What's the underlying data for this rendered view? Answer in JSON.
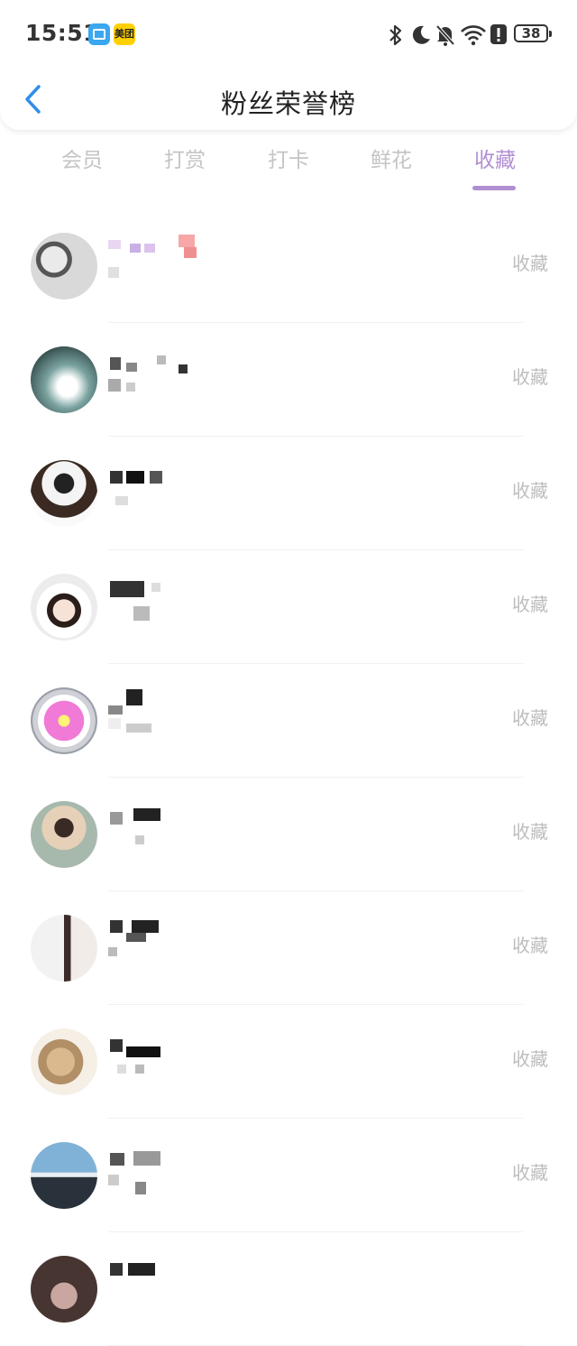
{
  "status_bar": {
    "time": "15:51",
    "app_badges": [
      "book-app-icon",
      "美团"
    ],
    "icons": [
      "bluetooth-icon",
      "moon-icon",
      "bell-muted-icon",
      "wifi-icon",
      "alert-icon"
    ],
    "battery": "38"
  },
  "header": {
    "back_icon": "chevron-left-icon",
    "title": "粉丝荣誉榜"
  },
  "tabs": [
    {
      "label": "会员",
      "active": false
    },
    {
      "label": "打赏",
      "active": false
    },
    {
      "label": "打卡",
      "active": false
    },
    {
      "label": "鲜花",
      "active": false
    },
    {
      "label": "收藏",
      "active": true
    }
  ],
  "colors": {
    "accent": "#b18fd3",
    "tab_inactive": "#c4c4c4",
    "action_text": "#bdbdbd",
    "back_icon": "#2f8fe8"
  },
  "fans": [
    {
      "avatar": "cartoon-avatar",
      "name": "[pixelated]",
      "action": "收藏"
    },
    {
      "avatar": "photo-avatar",
      "name": "[pixelated]",
      "action": "收藏"
    },
    {
      "avatar": "photo-avatar",
      "name": "[pixelated]",
      "action": "收藏"
    },
    {
      "avatar": "anime-avatar",
      "name": "[pixelated]",
      "action": "收藏"
    },
    {
      "avatar": "flower-avatar",
      "name": "[pixelated]",
      "action": "收藏"
    },
    {
      "avatar": "photo-avatar",
      "name": "[pixelated]",
      "action": "收藏"
    },
    {
      "avatar": "couple-avatar",
      "name": "[pixelated]",
      "action": "收藏"
    },
    {
      "avatar": "toy-avatar",
      "name": "[pixelated]",
      "action": "收藏"
    },
    {
      "avatar": "landscape-avatar",
      "name": "[pixelated]",
      "action": "收藏"
    },
    {
      "avatar": "photo-avatar",
      "name": "[pixelated]",
      "action": ""
    }
  ]
}
